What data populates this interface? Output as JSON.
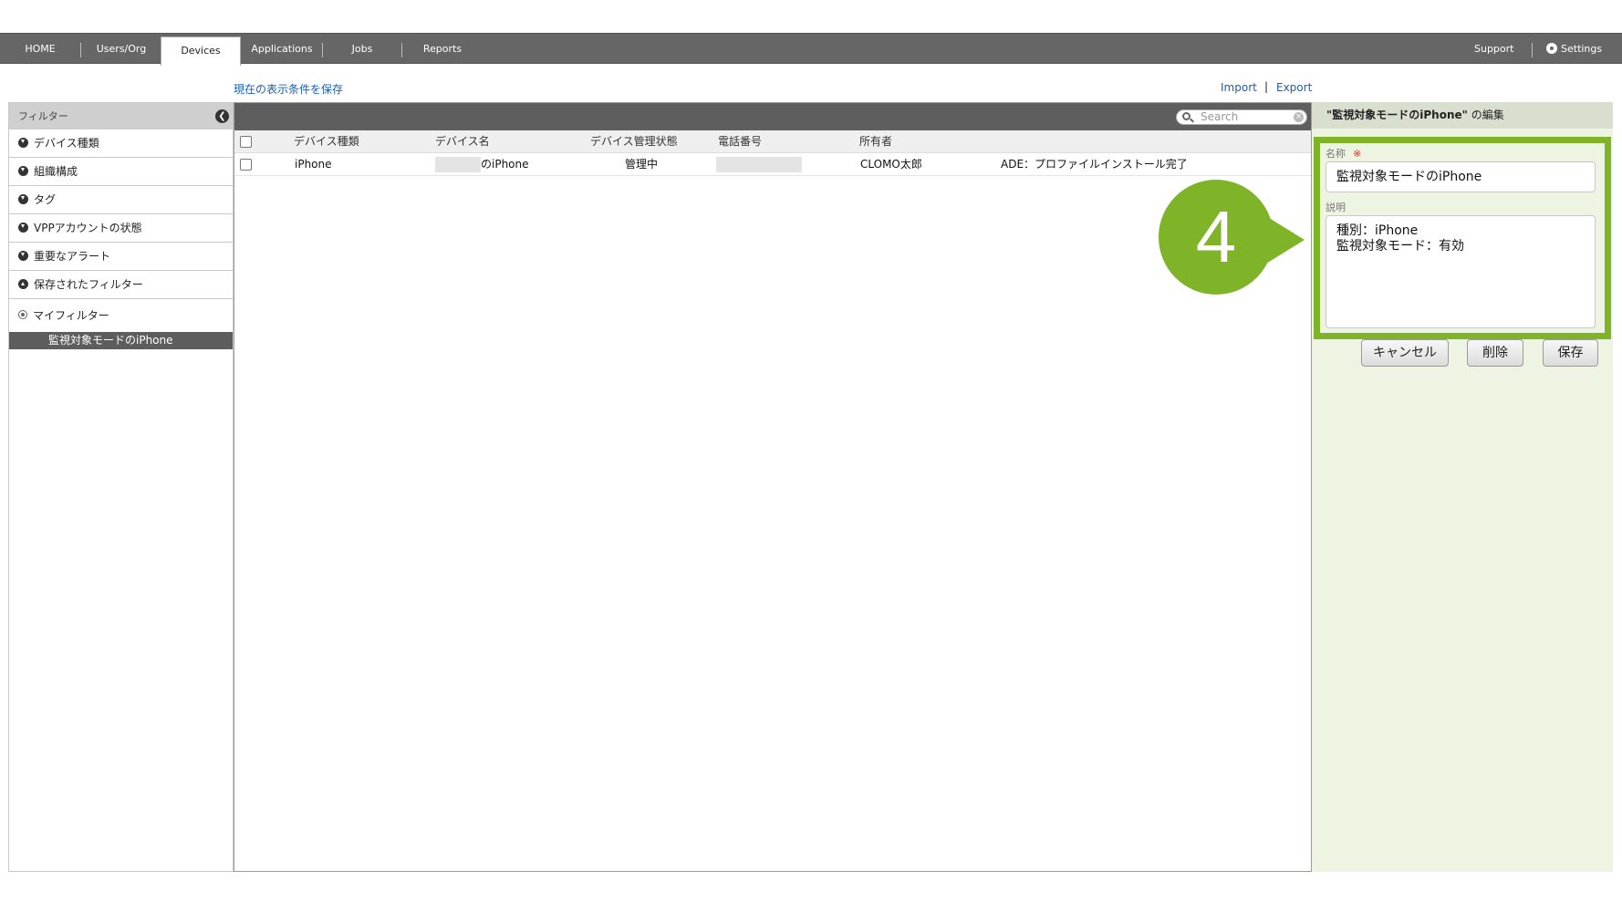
{
  "nav": {
    "tabs": [
      "HOME",
      "Users/Org",
      "Devices",
      "Applications",
      "Jobs",
      "Reports"
    ],
    "active_tab": "Devices",
    "support": "Support",
    "settings": "Settings"
  },
  "toolbar": {
    "save_conditions": "現在の表示条件を保存",
    "import": "Import",
    "separator": "|",
    "export": "Export"
  },
  "filter_panel": {
    "title": "フィルター",
    "items": [
      "デバイス種類",
      "組織構成",
      "タグ",
      "VPPアカウントの状態",
      "重要なアラート",
      "保存されたフィルター"
    ],
    "my_filter": "マイフィルター",
    "selected_filter": "監視対象モードのiPhone"
  },
  "table": {
    "search_placeholder": "Search",
    "columns": [
      "デバイス種類",
      "デバイス名",
      "デバイス管理状態",
      "電話番号",
      "所有者"
    ],
    "rows": [
      {
        "type": "iPhone",
        "name": "のiPhone",
        "status": "管理中",
        "phone": "",
        "owner": "CLOMO太郎",
        "note": "ADE：プロファイルインストール完了"
      }
    ]
  },
  "edit_panel": {
    "title_name": "\"監視対象モードのiPhone\"",
    "title_suffix": "の編集",
    "name_label": "名称",
    "required_mark": "※",
    "name_value": "監視対象モードのiPhone",
    "desc_label": "説明",
    "desc_value": "種別：iPhone\n監視対象モード：有効",
    "cancel": "キャンセル",
    "delete": "削除",
    "save": "保存"
  },
  "step_badge": "4",
  "colors": {
    "nav_bg": "#666666",
    "accent_green": "#7fb428",
    "link_blue": "#1a5fb4",
    "edit_panel_bg": "#eef4e2"
  }
}
